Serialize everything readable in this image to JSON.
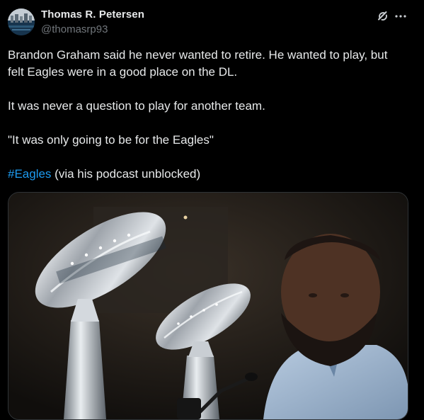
{
  "author": {
    "display_name": "Thomas R. Petersen",
    "handle": "@thomasrp93",
    "avatar_icon": "profile-avatar"
  },
  "header_actions": {
    "grok_icon": "grok-icon",
    "more_icon": "more-icon"
  },
  "tweet": {
    "line1": "Brandon Graham said he never wanted to retire. He wanted to play, but",
    "line2": "felt Eagles were in a good place on the DL.",
    "line3": "It was never a question to play for another team.",
    "line4": "\"It was only going to be for the Eagles\"",
    "hashtag": "#Eagles",
    "line5_rest": " (via his podcast unblocked)"
  },
  "media": {
    "description_icon": "photo",
    "colors": {
      "background": "#161412",
      "trophy_silver": "#c9ccd1",
      "jacket_denim": "#9fb6cf",
      "skin": "#5a3a2a"
    }
  },
  "colors": {
    "page_bg": "#000000",
    "text_primary": "#e7e9ea",
    "text_secondary": "#71767b",
    "link": "#1d9bf0",
    "border": "#2f3336"
  }
}
